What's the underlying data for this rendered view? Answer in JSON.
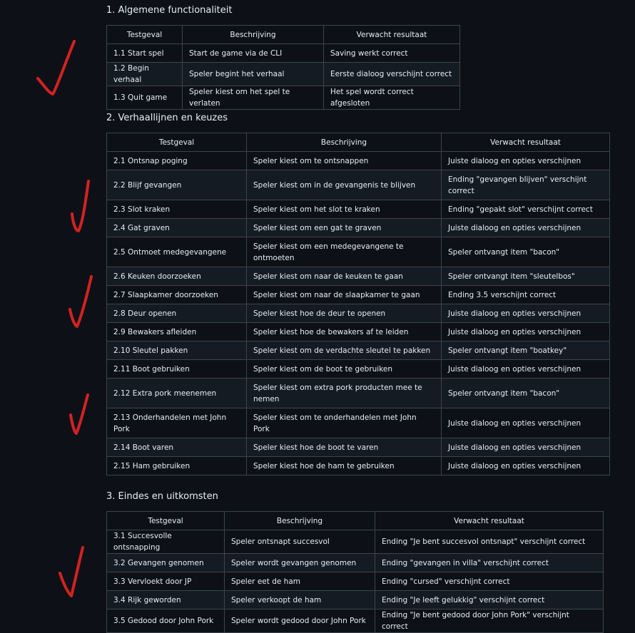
{
  "sections": [
    {
      "title": "1. Algemene functionaliteit",
      "headers": [
        "Testgeval",
        "Beschrijving",
        "Verwacht resultaat"
      ],
      "rows": [
        [
          "1.1 Start spel",
          "Start de game via de CLI",
          "Saving werkt correct"
        ],
        [
          "1.2 Begin verhaal",
          "Speler begint het verhaal",
          "Eerste dialoog verschijnt correct"
        ],
        [
          "1.3 Quit game",
          "Speler kiest om het spel te verlaten",
          "Het spel wordt correct afgesloten"
        ]
      ]
    },
    {
      "title": "2. Verhaallijnen en keuzes",
      "headers": [
        "Testgeval",
        "Beschrijving",
        "Verwacht resultaat"
      ],
      "rows": [
        [
          "2.1 Ontsnap poging",
          "Speler kiest om te ontsnappen",
          "Juiste dialoog en opties verschijnen"
        ],
        [
          "2.2 Blijf gevangen",
          "Speler kiest om in de gevangenis te blijven",
          "Ending \"gevangen blijven\" verschijnt correct"
        ],
        [
          "2.3 Slot kraken",
          "Speler kiest om het slot te kraken",
          "Ending \"gepakt slot\" verschijnt correct"
        ],
        [
          "2.4 Gat graven",
          "Speler kiest om een gat te graven",
          "Juiste dialoog en opties verschijnen"
        ],
        [
          "2.5 Ontmoet medegevangene",
          "Speler kiest om een medegevangene te ontmoeten",
          "Speler ontvangt item \"bacon\""
        ],
        [
          "2.6 Keuken doorzoeken",
          "Speler kiest om naar de keuken te gaan",
          "Speler ontvangt item \"sleutelbos\""
        ],
        [
          "2.7 Slaapkamer doorzoeken",
          "Speler kiest om naar de slaapkamer te gaan",
          "Ending 3.5 verschijnt correct"
        ],
        [
          "2.8 Deur openen",
          "Speler kiest hoe de deur te openen",
          "Juiste dialoog en opties verschijnen"
        ],
        [
          "2.9 Bewakers afleiden",
          "Speler kiest hoe de bewakers af te leiden",
          "Juiste dialoog en opties verschijnen"
        ],
        [
          "2.10 Sleutel pakken",
          "Speler kiest om de verdachte sleutel te pakken",
          "Speler ontvangt item \"boatkey\""
        ],
        [
          "2.11 Boot gebruiken",
          "Speler kiest om de boot te gebruiken",
          "Juiste dialoog en opties verschijnen"
        ],
        [
          "2.12 Extra pork meenemen",
          "Speler kiest om extra pork producten mee te nemen",
          "Speler ontvangt item \"bacon\""
        ],
        [
          "2.13 Onderhandelen met John Pork",
          "Speler kiest om te onderhandelen met John Pork",
          "Juiste dialoog en opties verschijnen"
        ],
        [
          "2.14 Boot varen",
          "Speler kiest hoe de boot te varen",
          "Juiste dialoog en opties verschijnen"
        ],
        [
          "2.15 Ham gebruiken",
          "Speler kiest hoe de ham te gebruiken",
          "Juiste dialoog en opties verschijnen"
        ]
      ]
    },
    {
      "title": "3. Eindes en uitkomsten",
      "headers": [
        "Testgeval",
        "Beschrijving",
        "Verwacht resultaat"
      ],
      "rows": [
        [
          "3.1 Succesvolle ontsnapping",
          "Speler ontsnapt succesvol",
          "Ending \"Je bent succesvol ontsnapt\" verschijnt correct"
        ],
        [
          "3.2 Gevangen genomen",
          "Speler wordt gevangen genomen",
          "Ending \"gevangen in villa\" verschijnt correct"
        ],
        [
          "3.3 Vervloekt door JP",
          "Speler eet de ham",
          "Ending \"cursed\" verschijnt correct"
        ],
        [
          "3.4 Rijk geworden",
          "Speler verkoopt de ham",
          "Ending \"Je leeft gelukkig\" verschijnt correct"
        ],
        [
          "3.5 Gedood door John Pork",
          "Speler wordt gedood door John Pork",
          "Ending \"Je bent gedood door John Pork\" verschijnt correct"
        ]
      ]
    }
  ],
  "annotation_icon": "red-handwritten-checkmark-icon",
  "annotation_color": "#d32222"
}
